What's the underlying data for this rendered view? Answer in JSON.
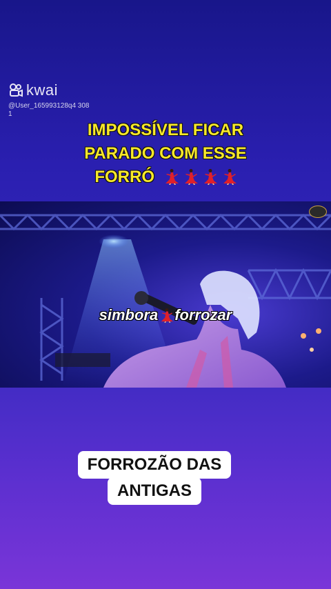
{
  "watermark": {
    "brand": "kwai",
    "handle": "@User_165993128q4 3081",
    "icon": "kwai-logo-icon"
  },
  "headline": {
    "line1": "IMPOSSÍVEL FICAR",
    "line2": "PARADO COM ESSE",
    "line3": "FORRÓ",
    "emoji_icon": "dancer-emoji-icon",
    "emoji_count": 4
  },
  "video": {
    "subtitle_left": "simbora",
    "subtitle_right": "forrozar"
  },
  "caption": {
    "line1": "FORROZÃO DAS",
    "line2": "ANTIGAS"
  },
  "colors": {
    "headline": "#f7e82a",
    "background_top": "#18168a",
    "background_bottom": "#7a35d8"
  }
}
